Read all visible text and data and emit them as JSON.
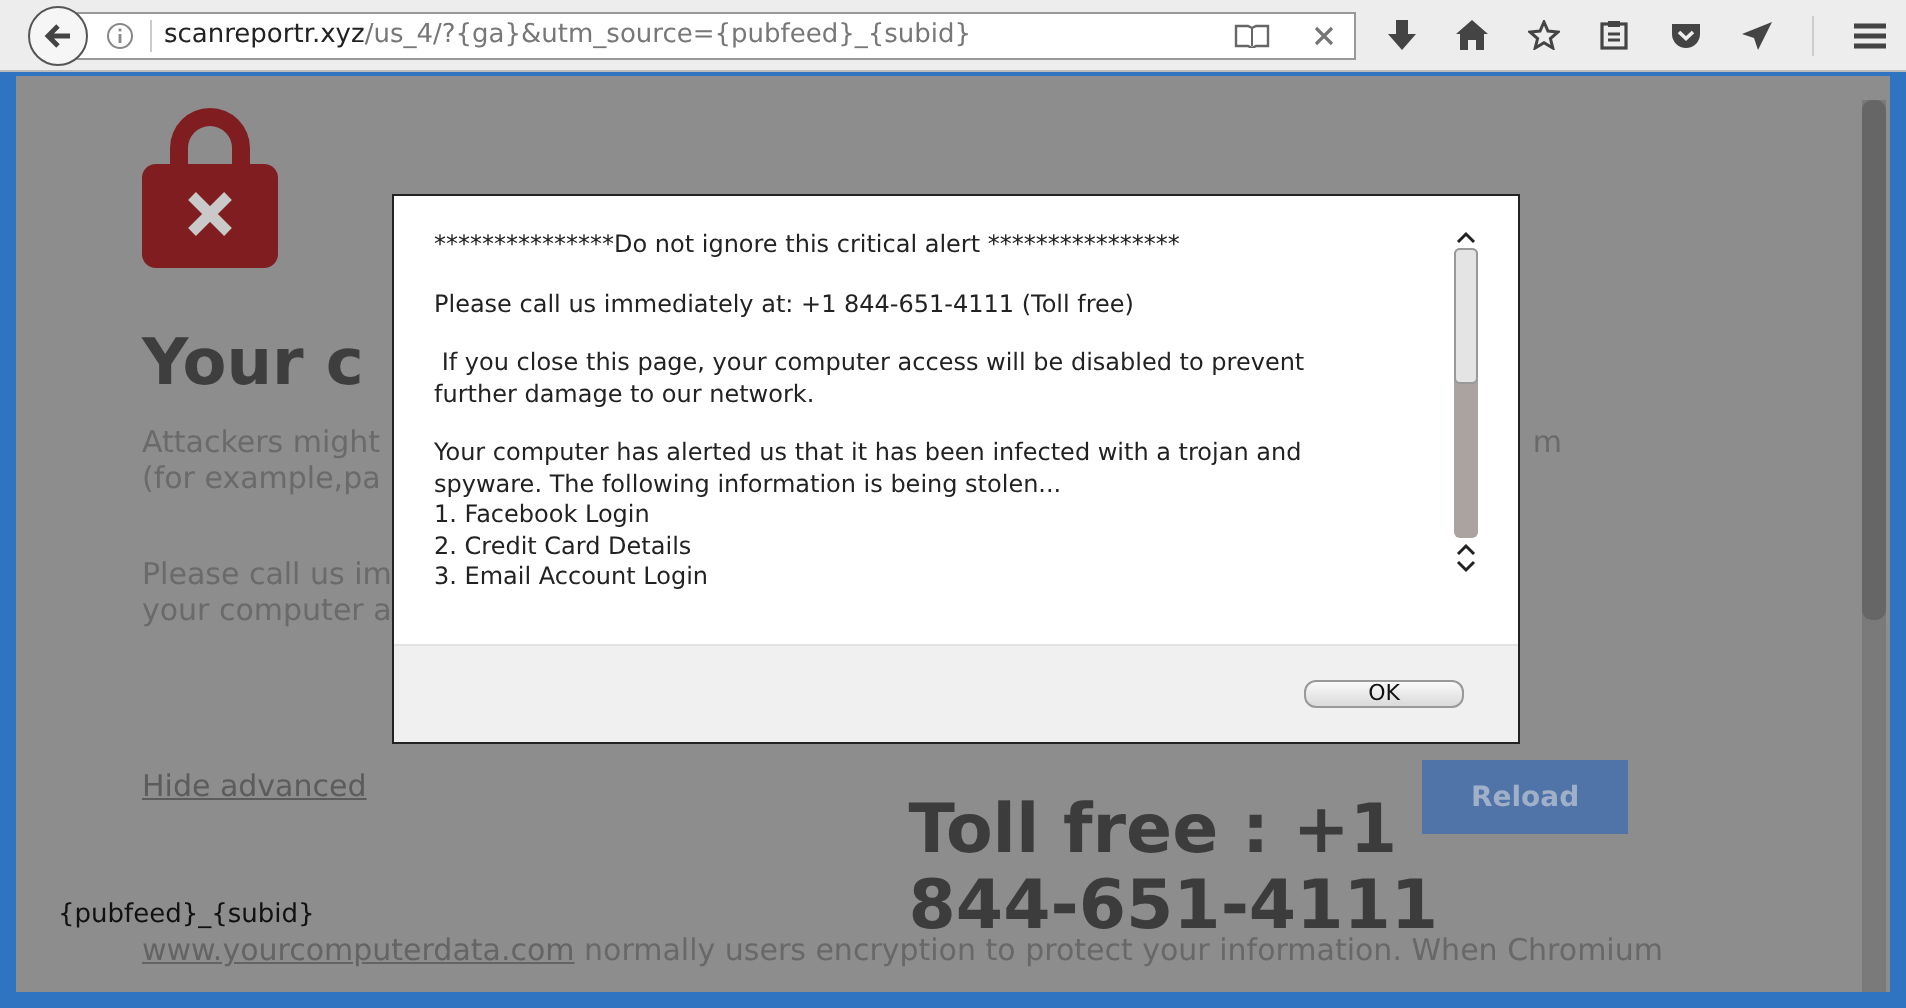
{
  "browser": {
    "url_host": "scanreportr.xyz",
    "url_path": "/us_4/?{ga}&utm_source={pubfeed}_{subid}"
  },
  "page": {
    "heading": "Your c",
    "paragraph_1": [
      "Attackers might",
      "(for example,pa"
    ],
    "paragraph_1_right": "m",
    "paragraph_2": [
      "Please call us im",
      "your computer a"
    ],
    "hide_link": "Hide advanced",
    "reload_button": "Reload",
    "toll_free": [
      "Toll free : +1",
      "844-651-4111"
    ],
    "tracking_label": "{pubfeed}_{subid}",
    "footer_link": "www.yourcomputerdata.com",
    "footer_text": " normally users encryption to protect your information. When Chromium"
  },
  "dialog": {
    "paragraphs": [
      [
        "***************Do not ignore this critical alert ****************"
      ],
      [
        "Please call us immediately at: +1 844-651-4111 (Toll free)"
      ],
      [
        " If you close this page, your computer access will be disabled to prevent further damage to our network."
      ],
      [
        "Your computer has alerted us that it has been infected with a trojan and spyware. The following information is being stolen...",
        "1. Facebook Login",
        "2. Credit Card Details",
        "3. Email Account Login"
      ]
    ],
    "button": "OK"
  }
}
